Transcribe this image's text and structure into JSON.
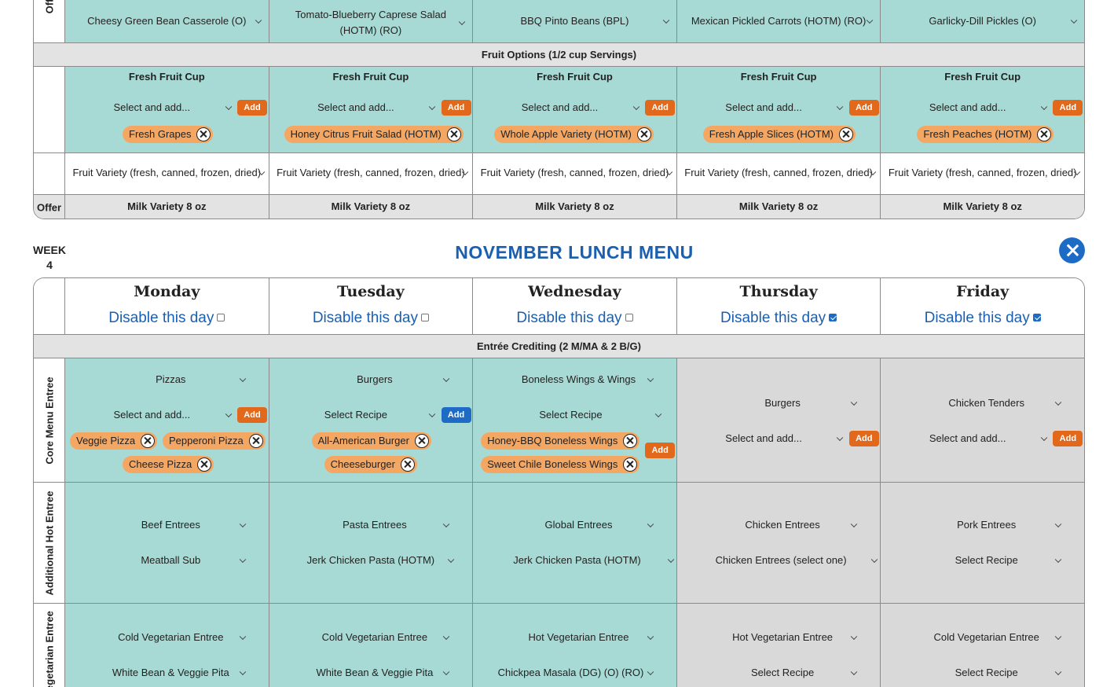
{
  "top": {
    "side_short": "Off",
    "side_offer": "Offer",
    "vegetable_row": [
      "Cheesy Green Bean Casserole (O)",
      "Tomato-Blueberry Caprese Salad (HOTM) (RO)",
      "BBQ Pinto Beans (BPL)",
      "Mexican Pickled Carrots (HOTM) (RO)",
      "Garlicky-Dill Pickles (O)"
    ],
    "fruit_band": "Fruit Options (1/2 cup Servings)",
    "fruit_cells": [
      {
        "title": "Fresh Fruit Cup",
        "select": "Select and add...",
        "add": "Add",
        "chip": "Fresh Grapes"
      },
      {
        "title": "Fresh Fruit Cup",
        "select": "Select and add...",
        "add": "Add",
        "chip": "Honey Citrus Fruit Salad (HOTM)"
      },
      {
        "title": "Fresh Fruit Cup",
        "select": "Select and add...",
        "add": "Add",
        "chip": "Whole Apple Variety (HOTM)"
      },
      {
        "title": "Fresh Fruit Cup",
        "select": "Select and add...",
        "add": "Add",
        "chip": "Fresh Apple Slices (HOTM)"
      },
      {
        "title": "Fresh Fruit Cup",
        "select": "Select and add...",
        "add": "Add",
        "chip": "Fresh Peaches (HOTM)"
      }
    ],
    "fruit_variety": "Fruit Variety (fresh, canned, frozen, dried)",
    "milk_side": "Offer",
    "milk": "Milk Variety 8 oz"
  },
  "week": {
    "label": "WEEK",
    "number": "4"
  },
  "menu_title": "NOVEMBER LUNCH MENU",
  "days": [
    {
      "name": "Monday",
      "disable": "Disable this day",
      "checked": false
    },
    {
      "name": "Tuesday",
      "disable": "Disable this day",
      "checked": false
    },
    {
      "name": "Wednesday",
      "disable": "Disable this day",
      "checked": false
    },
    {
      "name": "Thursday",
      "disable": "Disable this day",
      "checked": true
    },
    {
      "name": "Friday",
      "disable": "Disable this day",
      "checked": true
    }
  ],
  "entree_band": "Entrée Crediting (2 M/MA & 2 B/G)",
  "sides": {
    "core": "Core Menu Entree",
    "hot": "Additional Hot Entree",
    "veg": "Vegetarian Entree"
  },
  "core": [
    {
      "category": "Pizzas",
      "select": "Select and add...",
      "add": "Add",
      "chips": [
        "Veggie Pizza",
        "Pepperoni Pizza",
        "Cheese Pizza"
      ]
    },
    {
      "category": "Burgers",
      "select": "Select Recipe",
      "add": "Add",
      "chips": [
        "All-American Burger",
        "Cheeseburger"
      ]
    },
    {
      "category": "Boneless Wings & Wings",
      "select": "Select Recipe",
      "add": "Add",
      "chips": [
        "Honey-BBQ Boneless Wings",
        "Sweet Chile Boneless Wings"
      ]
    },
    {
      "category": "Burgers",
      "select": "Select and add...",
      "add": "Add",
      "chips": []
    },
    {
      "category": "Chicken Tenders",
      "select": "Select and add...",
      "add": "Add",
      "chips": []
    }
  ],
  "hot": [
    {
      "category": "Beef Entrees",
      "recipe": "Meatball Sub"
    },
    {
      "category": "Pasta Entrees",
      "recipe": "Jerk Chicken Pasta (HOTM)"
    },
    {
      "category": "Global Entrees",
      "recipe": "Jerk Chicken Pasta (HOTM)"
    },
    {
      "category": "Chicken Entrees",
      "recipe": "Chicken Entrees (select one)"
    },
    {
      "category": "Pork Entrees",
      "recipe": "Select Recipe"
    }
  ],
  "veg": [
    {
      "category": "Cold Vegetarian Entree",
      "recipe": "White Bean & Veggie Pita"
    },
    {
      "category": "Cold Vegetarian Entree",
      "recipe": "White Bean & Veggie Pita"
    },
    {
      "category": "Hot Vegetarian Entree",
      "recipe": "Chickpea Masala (DG) (O) (RO)"
    },
    {
      "category": "Hot Vegetarian Entree",
      "recipe": "Select Recipe"
    },
    {
      "category": "Cold Vegetarian Entree",
      "recipe": "Select Recipe"
    }
  ]
}
